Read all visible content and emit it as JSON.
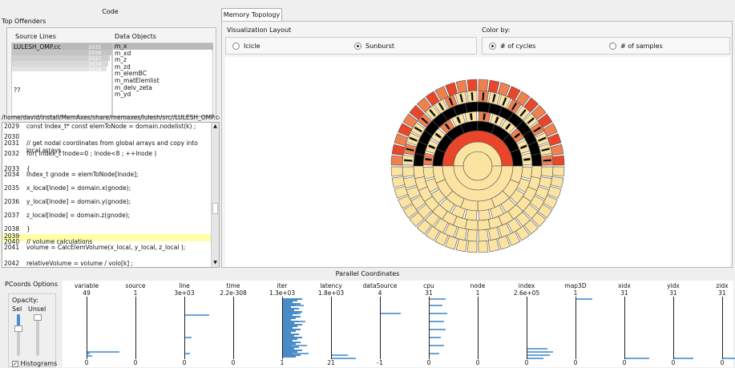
{
  "code_panel": {
    "title": "Code",
    "top_offenders_label": "Top Offenders",
    "source_lines_header": "Source Lines",
    "data_objects_header": "Data Objects",
    "source_file": "LULESH_OMP.cc",
    "source_bar_numbers": [
      "2035",
      "2036",
      "2037",
      "2034",
      "2033"
    ],
    "unknown_label": "??",
    "data_objects": [
      "m_x",
      "m_xd",
      "m_z",
      "m_zd",
      "m_elemBC",
      "m_matElemlist",
      "m_delv_zeta",
      "m_yd"
    ],
    "file_path": "/home/david/install/MemAxes/share/memaxes/lulesh/src//LULESH_OMP.cc",
    "code_lines": [
      {
        "n": "2029",
        "t": "const Index_t* const elemToNode = domain.nodelist(k) ;"
      },
      {
        "n": "2030",
        "t": ""
      },
      {
        "n": "2031",
        "t": "// get nodal coordinates from global arrays and copy into local arrays."
      },
      {
        "n": "2032",
        "t": "for( Index_t lnode=0 ; lnode<8 ; ++lnode )"
      },
      {
        "n": "2033",
        "t": "{"
      },
      {
        "n": "2034",
        "t": "Index_t gnode = elemToNode[lnode];"
      },
      {
        "n": "2035",
        "t": "x_local[lnode] = domain.x(gnode);"
      },
      {
        "n": "2036",
        "t": "y_local[lnode] = domain.y(gnode);"
      },
      {
        "n": "2037",
        "t": "z_local[lnode] = domain.z(gnode);"
      },
      {
        "n": "2038",
        "t": "}"
      },
      {
        "n": "2039",
        "t": ""
      },
      {
        "n": "2040",
        "t": "// volume calculations"
      },
      {
        "n": "2041",
        "t": "volume = CalcElemVolume(x_local, y_local, z_local );"
      },
      {
        "n": "2042",
        "t": "relativeVolume = volume / volo[k] ;"
      }
    ]
  },
  "topology_panel": {
    "tab_label": "Memory Topology",
    "viz_layout_label": "Visualization Layout",
    "color_by_label": "Color by:",
    "options_layout": [
      {
        "label": "Icicle",
        "selected": false
      },
      {
        "label": "Sunburst",
        "selected": true
      }
    ],
    "options_color": [
      {
        "label": "# of cycles",
        "selected": true
      },
      {
        "label": "# of samples",
        "selected": false
      }
    ],
    "colors": {
      "hot": "#e9452a",
      "warm": "#f08050",
      "pale": "#fbe3a2",
      "dark": "#000000"
    }
  },
  "pcoords": {
    "title": "Parallel Coordinates",
    "options_label": "PCoords Options",
    "opacity_label": "Opacity:",
    "sel_label": "Sel",
    "unsel_label": "Unsel",
    "histograms_label": "Histograms",
    "histograms_checked": true,
    "axes": [
      {
        "name": "variable",
        "max": "49",
        "min": "0"
      },
      {
        "name": "source",
        "max": "1",
        "min": "0"
      },
      {
        "name": "line",
        "max": "3e+03",
        "min": "0"
      },
      {
        "name": "time",
        "max": "2.2e-308",
        "min": "0"
      },
      {
        "name": "iter",
        "max": "1.3e+03",
        "min": "1"
      },
      {
        "name": "latency",
        "max": "1.8e+03",
        "min": "21"
      },
      {
        "name": "dataSource",
        "max": "4",
        "min": "-1"
      },
      {
        "name": "cpu",
        "max": "31",
        "min": "0"
      },
      {
        "name": "node",
        "max": "1",
        "min": "0"
      },
      {
        "name": "index",
        "max": "2.6e+05",
        "min": "0"
      },
      {
        "name": "map3D",
        "max": "1",
        "min": "0"
      },
      {
        "name": "xidx",
        "max": "31",
        "min": "0"
      },
      {
        "name": "yidx",
        "max": "31",
        "min": "0"
      },
      {
        "name": "zidx",
        "max": "31",
        "min": "0"
      }
    ]
  }
}
